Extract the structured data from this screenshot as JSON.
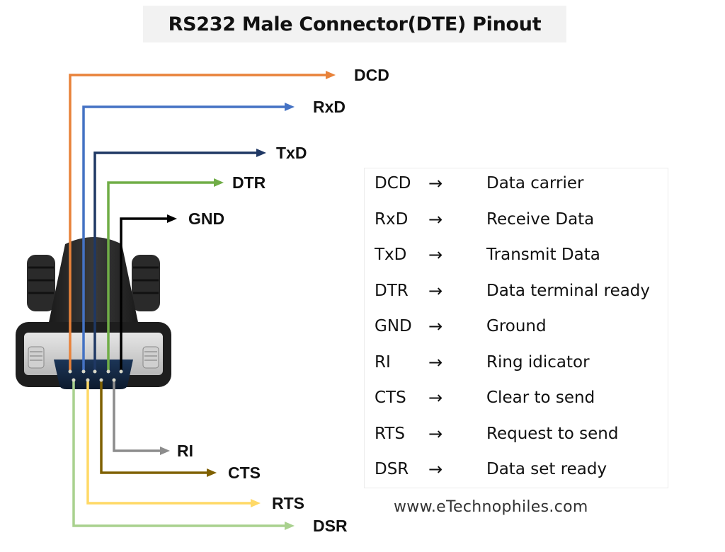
{
  "title": "RS232 Male Connector(DTE) Pinout",
  "connector": "DB9 male connector photo (black housing, metal shell, 9 pins)",
  "wires": [
    {
      "label": "DCD",
      "pin_row": "top",
      "color": "#e8823a"
    },
    {
      "label": "RxD",
      "pin_row": "top",
      "color": "#4472c4"
    },
    {
      "label": "TxD",
      "pin_row": "top",
      "color": "#1f3864"
    },
    {
      "label": "DTR",
      "pin_row": "top",
      "color": "#70ad47"
    },
    {
      "label": "GND",
      "pin_row": "top",
      "color": "#000000"
    },
    {
      "label": "RI",
      "pin_row": "bottom",
      "color": "#8c8c8c"
    },
    {
      "label": "CTS",
      "pin_row": "bottom",
      "color": "#7f6000"
    },
    {
      "label": "RTS",
      "pin_row": "bottom",
      "color": "#ffd966"
    },
    {
      "label": "DSR",
      "pin_row": "bottom",
      "color": "#a9d18e"
    }
  ],
  "table": {
    "arrow_symbol": "→",
    "rows": [
      {
        "abbr": "DCD",
        "desc": "Data carrier"
      },
      {
        "abbr": "RxD",
        "desc": "Receive Data"
      },
      {
        "abbr": "TxD",
        "desc": "Transmit Data"
      },
      {
        "abbr": "DTR",
        "desc": "Data terminal ready"
      },
      {
        "abbr": "GND",
        "desc": "Ground"
      },
      {
        "abbr": "RI",
        "desc": "Ring idicator"
      },
      {
        "abbr": "CTS",
        "desc": "Clear to send"
      },
      {
        "abbr": "RTS",
        "desc": "Request to send"
      },
      {
        "abbr": "DSR",
        "desc": "Data set ready"
      }
    ]
  },
  "website": "www.eTechnophiles.com"
}
